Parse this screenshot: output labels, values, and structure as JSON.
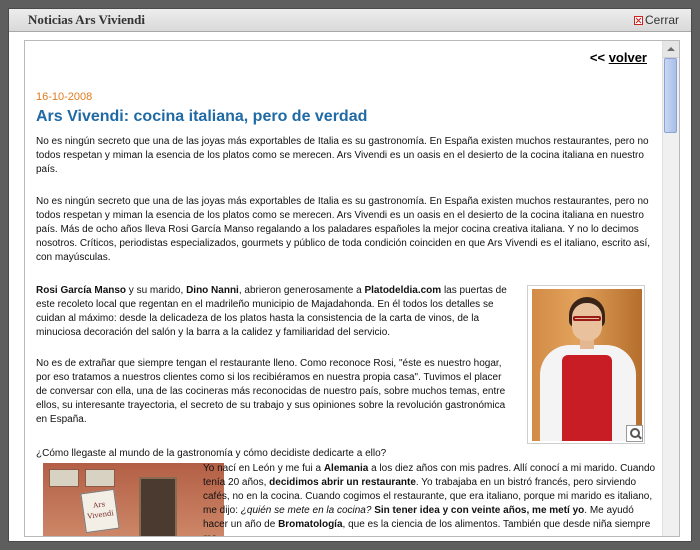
{
  "window": {
    "title": "Noticias Ars Viviendi",
    "close_label": "Cerrar"
  },
  "nav": {
    "back_prefix": "<<",
    "back_label": "volver"
  },
  "article": {
    "date": "16-10-2008",
    "headline": "Ars Vivendi: cocina italiana, pero de verdad",
    "p1": "No es ningún secreto que una de las joyas más exportables de Italia es su gastronomía. En España existen muchos restaurantes, pero no todos respetan y miman la esencia de los platos como se merecen. Ars Vivendi es un oasis en el desierto de la cocina italiana en nuestro país.",
    "p2": "No es ningún secreto que una de las joyas más exportables de Italia es su gastronomía. En España existen muchos restaurantes, pero no todos respetan y miman la esencia de los platos como se merecen. Ars Vivendi es un oasis en el desierto de la cocina italiana en nuestro país. Más de ocho años lleva Rosi García Manso regalando a los paladares españoles la mejor cocina creativa italiana. Y no lo decimos nosotros. Críticos, periodistas especializados, gourmets y público de toda condición coinciden en que Ars Vivendi es el italiano, escrito así, con mayúsculas.",
    "p3": {
      "bold1": "Rosi García Manso",
      "t1": " y su marido, ",
      "bold2": "Dino Nanni",
      "t2": ", abrieron generosamente a ",
      "bold3": "Platodeldia.com",
      "t3": " las puertas de este recoleto local que regentan en el madrileño municipio de Majadahonda. En él todos los detalles se cuidan al máximo: desde la delicadeza de los platos hasta la consistencia de la carta de vinos, de la minuciosa decoración del salón y la barra a la calidez y familiaridad del servicio."
    },
    "p4": "No es de extrañar que siempre tengan el restaurante lleno. Como reconoce Rosi, \"éste es nuestro hogar, por eso tratamos a nuestros clientes como si los recibiéramos en nuestra propia casa\". Tuvimos el placer de conversar con ella, una de las cocineras más reconocidas de nuestro país, sobre muchos temas, entre ellos, su interesante trayectoria, el secreto de su trabajo y sus opiniones sobre la revolución gastronómica en España.",
    "question": "¿Cómo llegaste al mundo de la gastronomía y cómo decidiste dedicarte a ello?",
    "p5": {
      "t1": "Yo nací en León y me fui a ",
      "bold1": "Alemania",
      "t2": " a los diez años con mis padres. Allí conocí a mi marido. Cuando tenía 20 años, ",
      "bold2": "decidimos abrir un restaurante",
      "t3": ". Yo trabajaba en un bistró francés, pero sirviendo cafés, no en la cocina. Cuando cogimos el restaurante, que era italiano, porque mi marido es italiano, me dijo: ",
      "italic1": "¿quién se mete en la cocina?",
      "t4": " ",
      "bold3": "Sin tener idea y con veinte años, me metí yo",
      "t5": ". Me ayudó hacer un año de ",
      "bold4": "Bromatología",
      "t6": ", que es la ciencia de los alimentos. También que desde niña siempre me"
    }
  },
  "images": {
    "restaurant_sign": "Ars Vivendi"
  }
}
